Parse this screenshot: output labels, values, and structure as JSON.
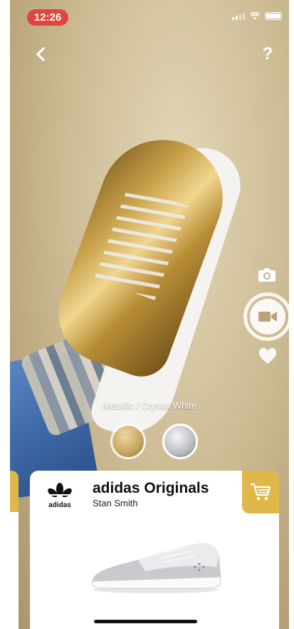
{
  "status_bar": {
    "time": "12:26"
  },
  "nav": {
    "back_icon": "chevron-left-icon",
    "back_symbol": "‹",
    "help_icon": "question-mark-icon",
    "help_symbol": "?"
  },
  "controls": {
    "photo_icon": "camera-icon",
    "record_icon": "video-camera-icon",
    "favorite_icon": "heart-icon"
  },
  "colorway": {
    "label": "Metallic / Crystal White",
    "options": [
      {
        "name": "gold",
        "color": "#c9a24c"
      },
      {
        "name": "silver",
        "color": "#b9bcc0"
      }
    ]
  },
  "product_card": {
    "brand_logo_text": "adidas",
    "brand": "adidas Originals",
    "product": "Stan Smith",
    "cart_icon": "shopping-cart-icon",
    "accent_color": "#e0b84a"
  }
}
